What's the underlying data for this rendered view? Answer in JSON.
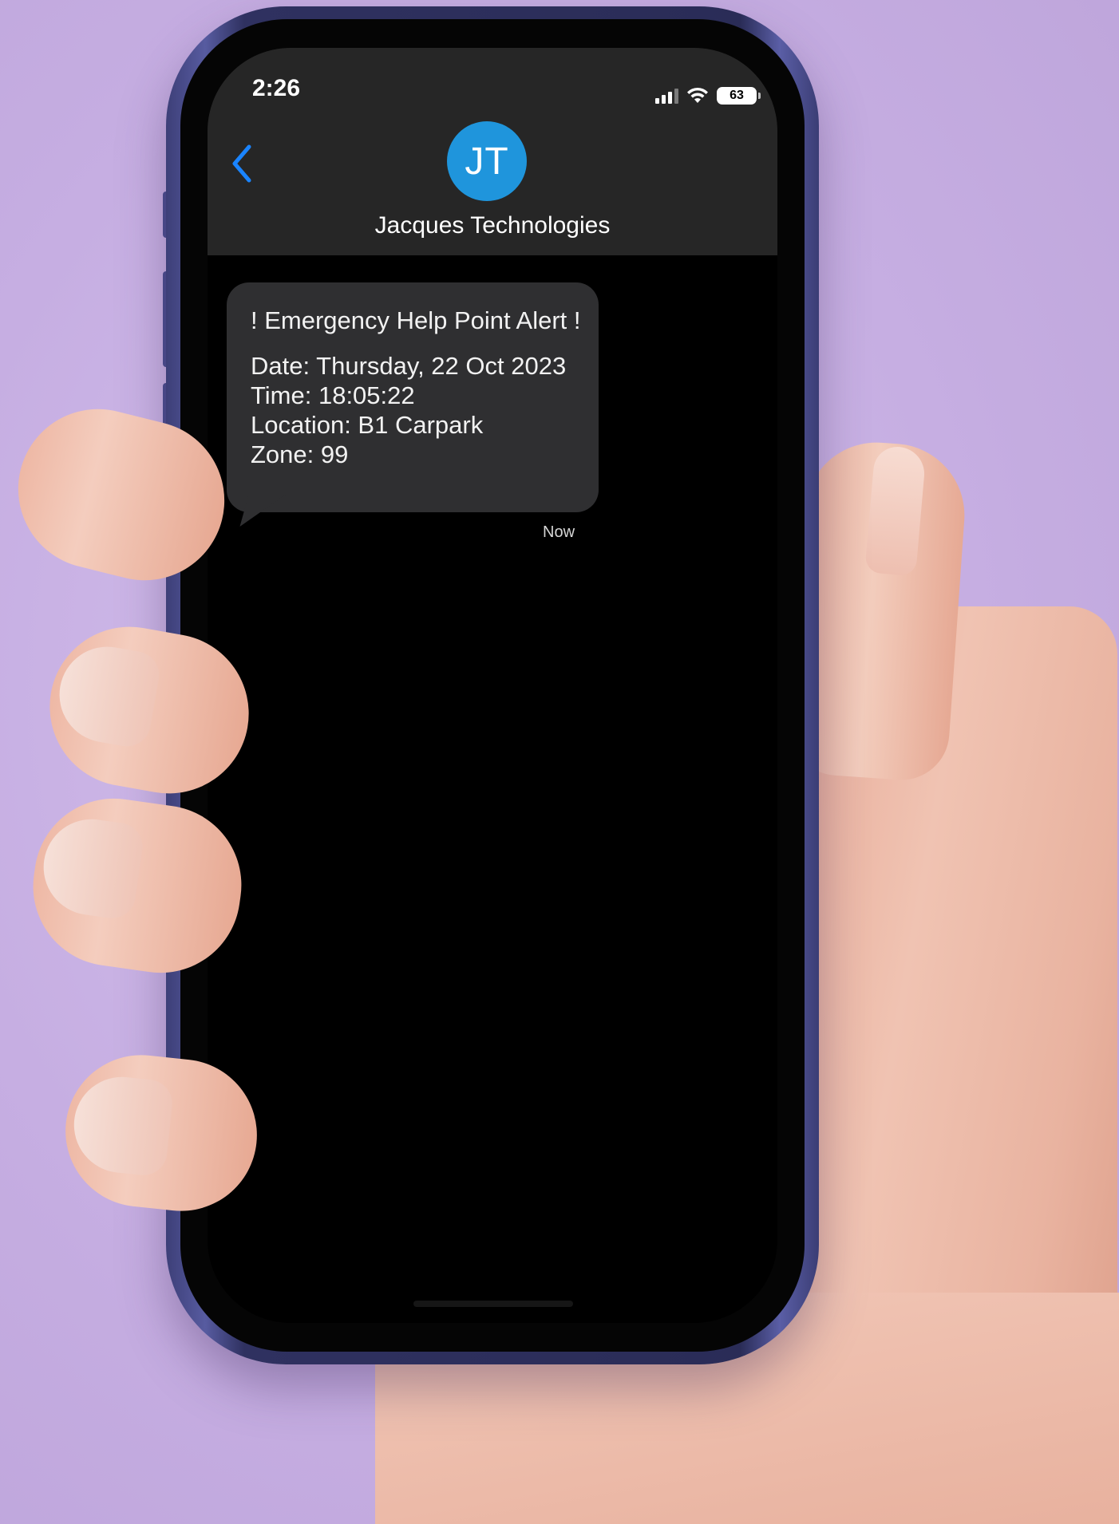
{
  "status_bar": {
    "time": "2:26",
    "battery_level": "63",
    "signal_icon": "cellular-signal-icon",
    "wifi_icon": "wifi-icon"
  },
  "header": {
    "back_icon": "chevron-left-icon",
    "avatar_initials": "JT",
    "contact_name": "Jacques Technologies"
  },
  "message": {
    "title": "! Emergency Help Point Alert !",
    "lines": [
      "Date: Thursday, 22 Oct 2023",
      "Time: 18:05:22",
      "Location: B1 Carpark",
      "Zone: 99"
    ],
    "timestamp": "Now"
  },
  "colors": {
    "accent": "#1f95dc",
    "back_chevron": "#1a84ff",
    "bubble": "#2f2f31",
    "background": "#c9b3e3"
  }
}
